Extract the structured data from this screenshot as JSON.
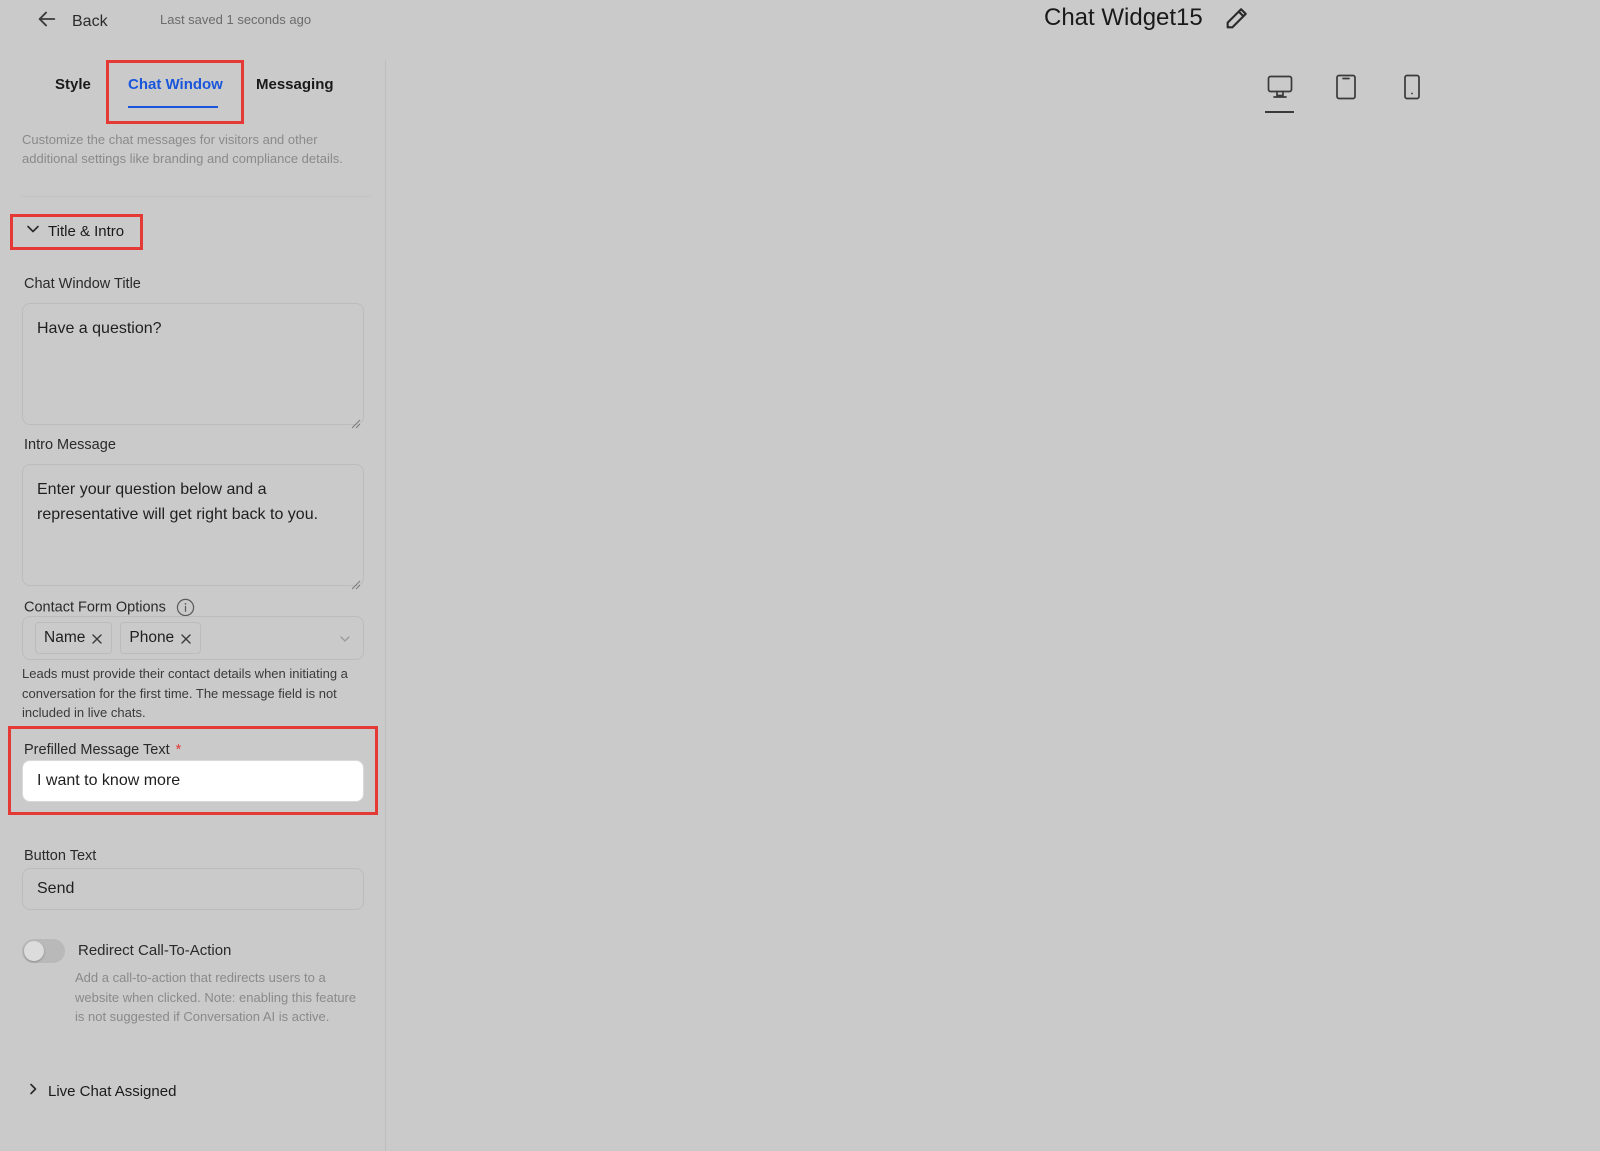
{
  "header": {
    "back_label": "Back",
    "last_saved": "Last saved 1 seconds ago",
    "widget_title": "Chat Widget15"
  },
  "tabs": [
    {
      "label": "Style",
      "active": false
    },
    {
      "label": "Chat Window",
      "active": true
    },
    {
      "label": "Messaging",
      "active": false
    }
  ],
  "description": "Customize the chat messages for visitors and other additional settings like branding and compliance details.",
  "sections": {
    "title_intro": "Title & Intro",
    "live_chat": "Live Chat Assigned"
  },
  "fields": {
    "chat_window_title": {
      "label": "Chat Window Title",
      "value": "Have a question?"
    },
    "intro_message": {
      "label": "Intro Message",
      "value": "Enter your question below and a representative will get right back to you."
    },
    "contact_form_options": {
      "label": "Contact Form Options",
      "selected": [
        "Name",
        "Phone"
      ],
      "help": "Leads must provide their contact details when initiating a conversation for the first time. The message field is not included in live chats."
    },
    "prefilled_message": {
      "label": "Prefilled Message Text",
      "required_mark": "*",
      "value": "I want to know more"
    },
    "button_text": {
      "label": "Button Text",
      "value": "Send"
    },
    "redirect_cta": {
      "label": "Redirect Call-To-Action",
      "enabled": false,
      "description": "Add a call-to-action that redirects users to a website when clicked. Note: enabling this feature is not suggested if Conversation AI is active."
    }
  },
  "preview_devices": [
    {
      "icon": "desktop-icon",
      "active": true
    },
    {
      "icon": "tablet-icon",
      "active": false
    },
    {
      "icon": "mobile-icon",
      "active": false
    }
  ],
  "colors": {
    "accent": "#1a56db",
    "highlight": "#e53935",
    "background": "#cacaca"
  }
}
